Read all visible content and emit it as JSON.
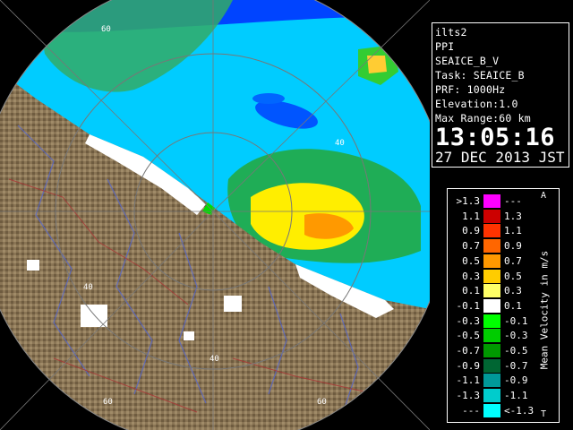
{
  "info": {
    "station": "ilts2",
    "mode": "PPI",
    "product": "SEAICE_B_V",
    "task": "Task: SEAICE_B",
    "prf": "PRF: 1000Hz",
    "elevation": "Elevation:1.0",
    "max_range": "Max Range:60 km",
    "time": "13:05:16",
    "date": "27 DEC 2013 JST"
  },
  "legend": {
    "title": "Mean Velocity in m/s",
    "arrow_up": "A",
    "arrow_down": "T",
    "rows": [
      {
        "left": ">1.3",
        "right": "---",
        "color": "#ff00ff"
      },
      {
        "left": "1.1",
        "right": "1.3",
        "color": "#cc0000"
      },
      {
        "left": "0.9",
        "right": "1.1",
        "color": "#ff3300"
      },
      {
        "left": "0.7",
        "right": "0.9",
        "color": "#ff6600"
      },
      {
        "left": "0.5",
        "right": "0.7",
        "color": "#ff9900"
      },
      {
        "left": "0.3",
        "right": "0.5",
        "color": "#ffcc00"
      },
      {
        "left": "0.1",
        "right": "0.3",
        "color": "#ffff66"
      },
      {
        "left": "-0.1",
        "right": "0.1",
        "color": "#ffffff"
      },
      {
        "left": "-0.3",
        "right": "-0.1",
        "color": "#00ff00"
      },
      {
        "left": "-0.5",
        "right": "-0.3",
        "color": "#00cc00"
      },
      {
        "left": "-0.7",
        "right": "-0.5",
        "color": "#009900"
      },
      {
        "left": "-0.9",
        "right": "-0.7",
        "color": "#006633"
      },
      {
        "left": "-1.1",
        "right": "-0.9",
        "color": "#009999"
      },
      {
        "left": "-1.3",
        "right": "-1.1",
        "color": "#00cccc"
      },
      {
        "left": "---",
        "right": "<-1.3",
        "color": "#00ffff"
      }
    ]
  },
  "range_labels": {
    "r40_top": "40",
    "r40_left": "40",
    "r40_bottom": "40",
    "r60_topleft": "60",
    "r60_bottomleft": "60",
    "r60_bottomright": "60"
  },
  "colors": {
    "background": "#000000",
    "land": "#8a7555",
    "sea_echo": "#00ccff",
    "deep_blue": "#0055ff",
    "ring": "#7f7f7f"
  }
}
